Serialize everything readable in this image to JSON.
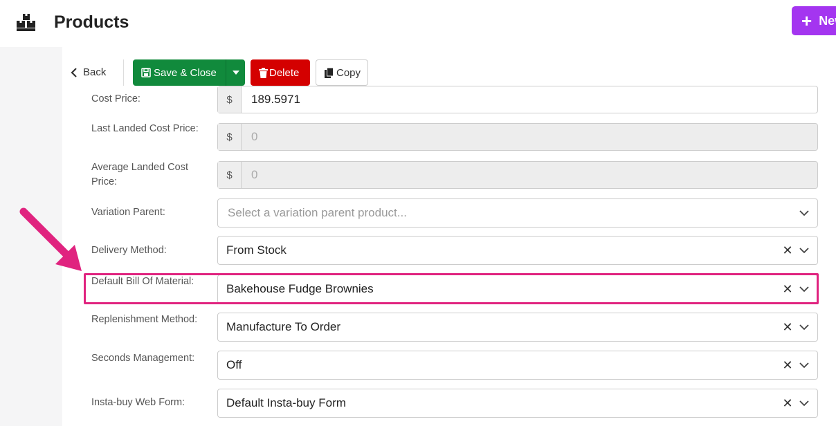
{
  "header": {
    "title": "Products",
    "new_label": "New"
  },
  "toolbar": {
    "back_label": "Back",
    "save_label": "Save & Close",
    "delete_label": "Delete",
    "copy_label": "Copy"
  },
  "fields": {
    "cost_price": {
      "label": "Cost Price:",
      "prefix": "$",
      "value": "189.5971"
    },
    "last_landed": {
      "label": "Last Landed Cost Price:",
      "prefix": "$",
      "value": "0"
    },
    "avg_landed": {
      "label": "Average Landed Cost Price:",
      "prefix": "$",
      "value": "0"
    },
    "variation_parent": {
      "label": "Variation Parent:",
      "placeholder": "Select a variation parent product..."
    },
    "delivery_method": {
      "label": "Delivery Method:",
      "value": "From Stock"
    },
    "default_bom": {
      "label": "Default Bill Of Material:",
      "value": "Bakehouse Fudge Brownies"
    },
    "replenishment": {
      "label": "Replenishment Method:",
      "value": "Manufacture To Order"
    },
    "seconds": {
      "label": "Seconds Management:",
      "value": "Off"
    },
    "insta_buy": {
      "label": "Insta-buy Web Form:",
      "value": "Default Insta-buy Form"
    }
  },
  "colors": {
    "accent_new": "#a435f0",
    "save": "#118a3c",
    "delete": "#d40000",
    "highlight": "#e0237f"
  }
}
